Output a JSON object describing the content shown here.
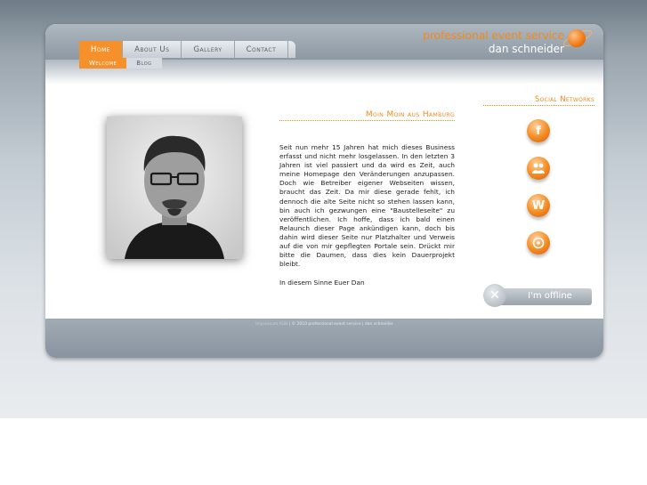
{
  "brand": {
    "line1": "professional event service",
    "line2": "dan schneider"
  },
  "nav": {
    "items": [
      {
        "label": "Home",
        "active": true
      },
      {
        "label": "About Us",
        "active": false
      },
      {
        "label": "Gallery",
        "active": false
      },
      {
        "label": "Contact",
        "active": false
      }
    ],
    "subitems": [
      {
        "label": "Welcome",
        "active": true
      },
      {
        "label": "Blog",
        "active": false
      }
    ]
  },
  "article": {
    "title": "Moin Moin aus Hamburg",
    "body": "Seit nun mehr 15 Jahren hat mich dieses Business erfasst und nicht mehr losgelassen. In den letzten 3 Jahren ist viel passiert und da wird es Zeit, auch meine Homepage den Veränderungen anzupassen. Doch wie Betreiber eigener Webseiten wissen, braucht das Zeit. Da mir diese gerade fehlt, ich dennoch die alte Seite nicht so stehen lassen kann, bin auch ich gezwungen eine \"Baustelleseite\" zu veröffentlichen. Ich hoffe, dass ich bald einen Relaunch dieser Page ankündigen kann, doch bis dahin wird dieser Seite nur Platzhalter und Verweis auf die von mir gepflegten Portale sein. Drückt mir bitte die Daumen, dass dies kein Dauerprojekt bleibt.",
    "sign": "In diesem Sinne Euer Dan"
  },
  "social": {
    "title": "Social Networks",
    "icons": [
      "facebook-icon",
      "people-icon",
      "wordpress-icon",
      "share-icon"
    ]
  },
  "status": {
    "label": "I'm offline"
  },
  "footer": {
    "impressum": "Impressum",
    "agb": "AGB",
    "copyright": "| © 2010 professional event service | dan schneider"
  },
  "colors": {
    "accent": "#f5902a",
    "header": "#8d98a2"
  }
}
